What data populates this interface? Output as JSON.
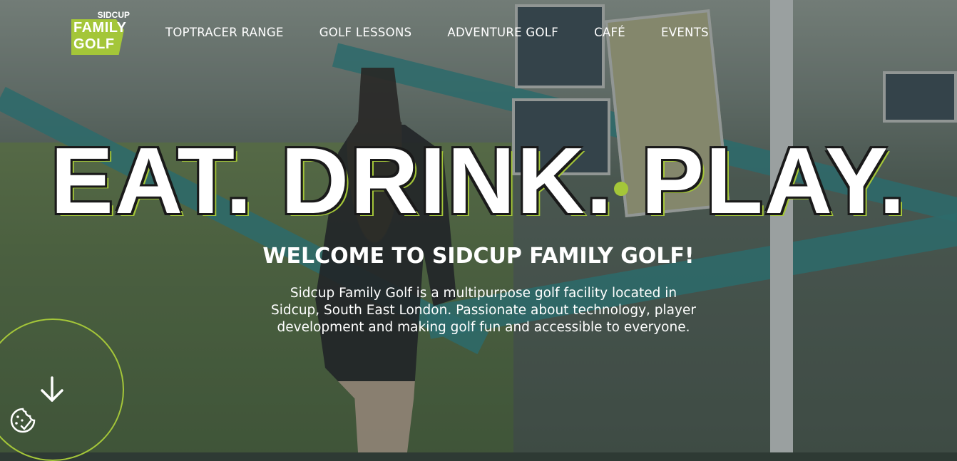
{
  "logo": {
    "small": "SIDCUP",
    "line1": "FAMILY",
    "line2": "GOLF"
  },
  "nav": {
    "items": [
      {
        "label": "TOPTRACER RANGE"
      },
      {
        "label": "GOLF LESSONS"
      },
      {
        "label": "ADVENTURE GOLF"
      },
      {
        "label": "CAFÉ"
      },
      {
        "label": "EVENTS"
      }
    ]
  },
  "hero": {
    "headline": "EAT. DRINK. PLAY.",
    "welcome": "WELCOME TO SIDCUP FAMILY GOLF!",
    "description": "Sidcup Family Golf is a multipurpose golf facility located in Sidcup, South East London. Passionate about technology, player development and making golf fun and accessible to everyone."
  },
  "icons": {
    "scroll": "arrow-down-icon",
    "cookie": "cookie-settings-icon"
  },
  "colors": {
    "accent": "#a4c639",
    "text": "#ffffff"
  }
}
